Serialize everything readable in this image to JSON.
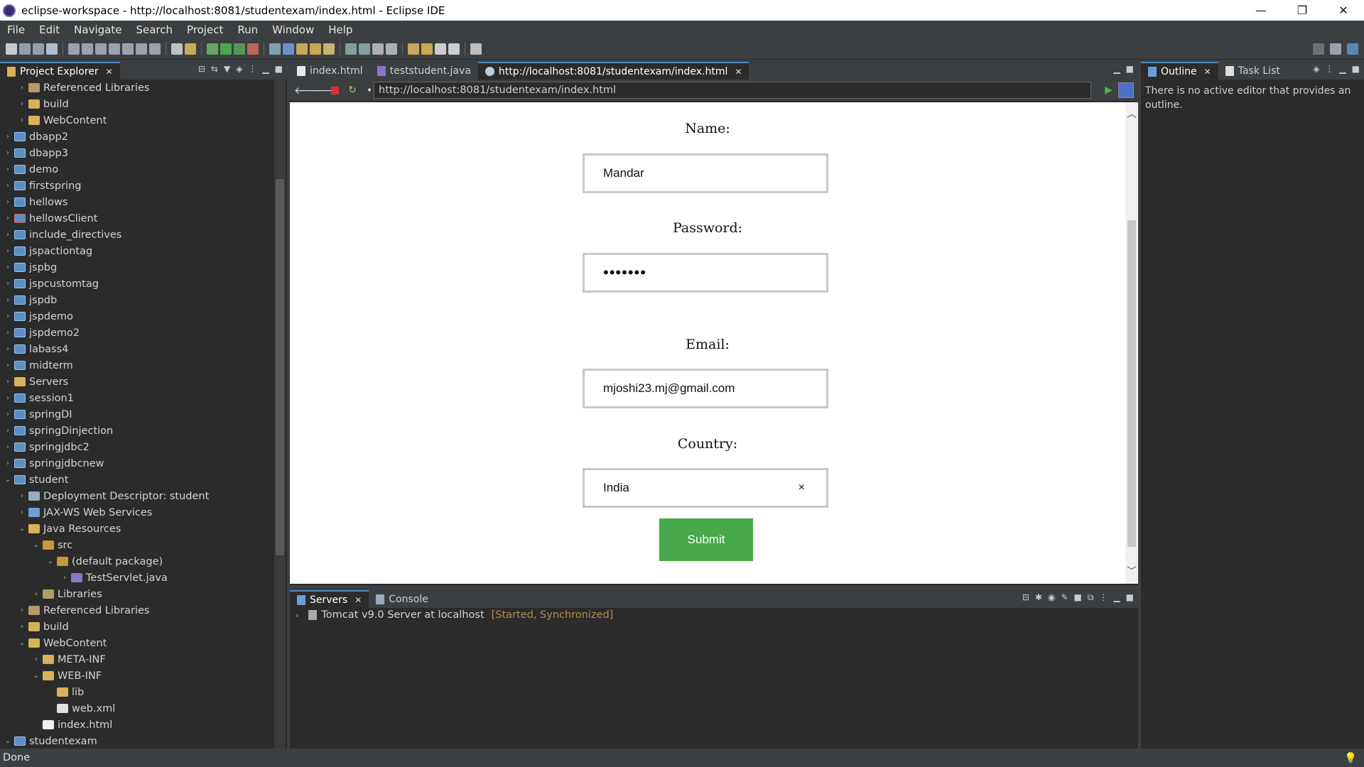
{
  "window": {
    "title": "eclipse-workspace - http://localhost:8081/studentexam/index.html - Eclipse IDE",
    "minimize": "—",
    "restore": "❐",
    "close": "✕"
  },
  "menu": [
    "File",
    "Edit",
    "Navigate",
    "Search",
    "Project",
    "Run",
    "Window",
    "Help"
  ],
  "explorer": {
    "tab_label": "Project Explorer",
    "items": [
      {
        "label": "Referenced Libraries",
        "depth": 1,
        "arrow": "›",
        "icon": "lib"
      },
      {
        "label": "build",
        "depth": 1,
        "arrow": "›",
        "icon": "folder"
      },
      {
        "label": "WebContent",
        "depth": 1,
        "arrow": "›",
        "icon": "folder"
      },
      {
        "label": "dbapp2",
        "depth": 0,
        "arrow": "›",
        "icon": "project"
      },
      {
        "label": "dbapp3",
        "depth": 0,
        "arrow": "›",
        "icon": "project"
      },
      {
        "label": "demo",
        "depth": 0,
        "arrow": "›",
        "icon": "project"
      },
      {
        "label": "firstspring",
        "depth": 0,
        "arrow": "›",
        "icon": "project"
      },
      {
        "label": "hellows",
        "depth": 0,
        "arrow": "›",
        "icon": "project"
      },
      {
        "label": "hellowsClient",
        "depth": 0,
        "arrow": "›",
        "icon": "project-err"
      },
      {
        "label": "include_directives",
        "depth": 0,
        "arrow": "›",
        "icon": "project"
      },
      {
        "label": "jspactiontag",
        "depth": 0,
        "arrow": "›",
        "icon": "project"
      },
      {
        "label": "jspbg",
        "depth": 0,
        "arrow": "›",
        "icon": "project"
      },
      {
        "label": "jspcustomtag",
        "depth": 0,
        "arrow": "›",
        "icon": "project"
      },
      {
        "label": "jspdb",
        "depth": 0,
        "arrow": "›",
        "icon": "project"
      },
      {
        "label": "jspdemo",
        "depth": 0,
        "arrow": "›",
        "icon": "project"
      },
      {
        "label": "jspdemo2",
        "depth": 0,
        "arrow": "›",
        "icon": "project"
      },
      {
        "label": "labass4",
        "depth": 0,
        "arrow": "›",
        "icon": "project"
      },
      {
        "label": "midterm",
        "depth": 0,
        "arrow": "›",
        "icon": "project"
      },
      {
        "label": "Servers",
        "depth": 0,
        "arrow": "›",
        "icon": "folder"
      },
      {
        "label": "session1",
        "depth": 0,
        "arrow": "›",
        "icon": "project"
      },
      {
        "label": "springDI",
        "depth": 0,
        "arrow": "›",
        "icon": "project"
      },
      {
        "label": "springDinjection",
        "depth": 0,
        "arrow": "›",
        "icon": "project"
      },
      {
        "label": "springjdbc2",
        "depth": 0,
        "arrow": "›",
        "icon": "project"
      },
      {
        "label": "springjdbcnew",
        "depth": 0,
        "arrow": "›",
        "icon": "project"
      },
      {
        "label": "student",
        "depth": 0,
        "arrow": "⌄",
        "icon": "project"
      },
      {
        "label": "Deployment Descriptor: student",
        "depth": 1,
        "arrow": "›",
        "icon": "dd"
      },
      {
        "label": "JAX-WS Web Services",
        "depth": 1,
        "arrow": "›",
        "icon": "ws"
      },
      {
        "label": "Java Resources",
        "depth": 1,
        "arrow": "⌄",
        "icon": "folder"
      },
      {
        "label": "src",
        "depth": 2,
        "arrow": "⌄",
        "icon": "pkg"
      },
      {
        "label": "(default package)",
        "depth": 3,
        "arrow": "⌄",
        "icon": "pkg"
      },
      {
        "label": "TestServlet.java",
        "depth": 4,
        "arrow": "›",
        "icon": "java"
      },
      {
        "label": "Libraries",
        "depth": 2,
        "arrow": "›",
        "icon": "lib"
      },
      {
        "label": "Referenced Libraries",
        "depth": 1,
        "arrow": "›",
        "icon": "lib"
      },
      {
        "label": "build",
        "depth": 1,
        "arrow": "›",
        "icon": "folder"
      },
      {
        "label": "WebContent",
        "depth": 1,
        "arrow": "⌄",
        "icon": "folder"
      },
      {
        "label": "META-INF",
        "depth": 2,
        "arrow": "›",
        "icon": "folder"
      },
      {
        "label": "WEB-INF",
        "depth": 2,
        "arrow": "⌄",
        "icon": "folder"
      },
      {
        "label": "lib",
        "depth": 3,
        "arrow": "",
        "icon": "folder"
      },
      {
        "label": "web.xml",
        "depth": 3,
        "arrow": "",
        "icon": "xml"
      },
      {
        "label": "index.html",
        "depth": 2,
        "arrow": "",
        "icon": "html"
      },
      {
        "label": "studentexam",
        "depth": 0,
        "arrow": "⌄",
        "icon": "project"
      }
    ]
  },
  "editor": {
    "tabs": [
      {
        "label": "index.html",
        "active": false
      },
      {
        "label": "teststudent.java",
        "active": false
      },
      {
        "label": "http://localhost:8081/studentexam/index.html",
        "active": true
      }
    ],
    "url": "http://localhost:8081/studentexam/index.html"
  },
  "form": {
    "name_label": "Name:",
    "name_value": "Mandar",
    "password_label": "Password:",
    "password_value": "•••••••",
    "email_label": "Email:",
    "email_value": "mjoshi23.mj@gmail.com",
    "country_label": "Country:",
    "country_value": "India",
    "country_clear": "×",
    "submit_label": "Submit",
    "submit_color": "#47a94a"
  },
  "bottom": {
    "tabs": [
      {
        "label": "Servers",
        "active": true
      },
      {
        "label": "Console",
        "active": false
      }
    ],
    "server_name": "Tomcat v9.0 Server at localhost",
    "server_status": "[Started, Synchronized]"
  },
  "outline": {
    "tabs": [
      {
        "label": "Outline",
        "active": true
      },
      {
        "label": "Task List",
        "active": false
      }
    ],
    "message": "There is no active editor that provides an outline."
  },
  "status": {
    "text": "Done"
  },
  "colors": {
    "accent": "#4a88c7",
    "background": "#2b2b2b",
    "chrome": "#3c3f41"
  }
}
